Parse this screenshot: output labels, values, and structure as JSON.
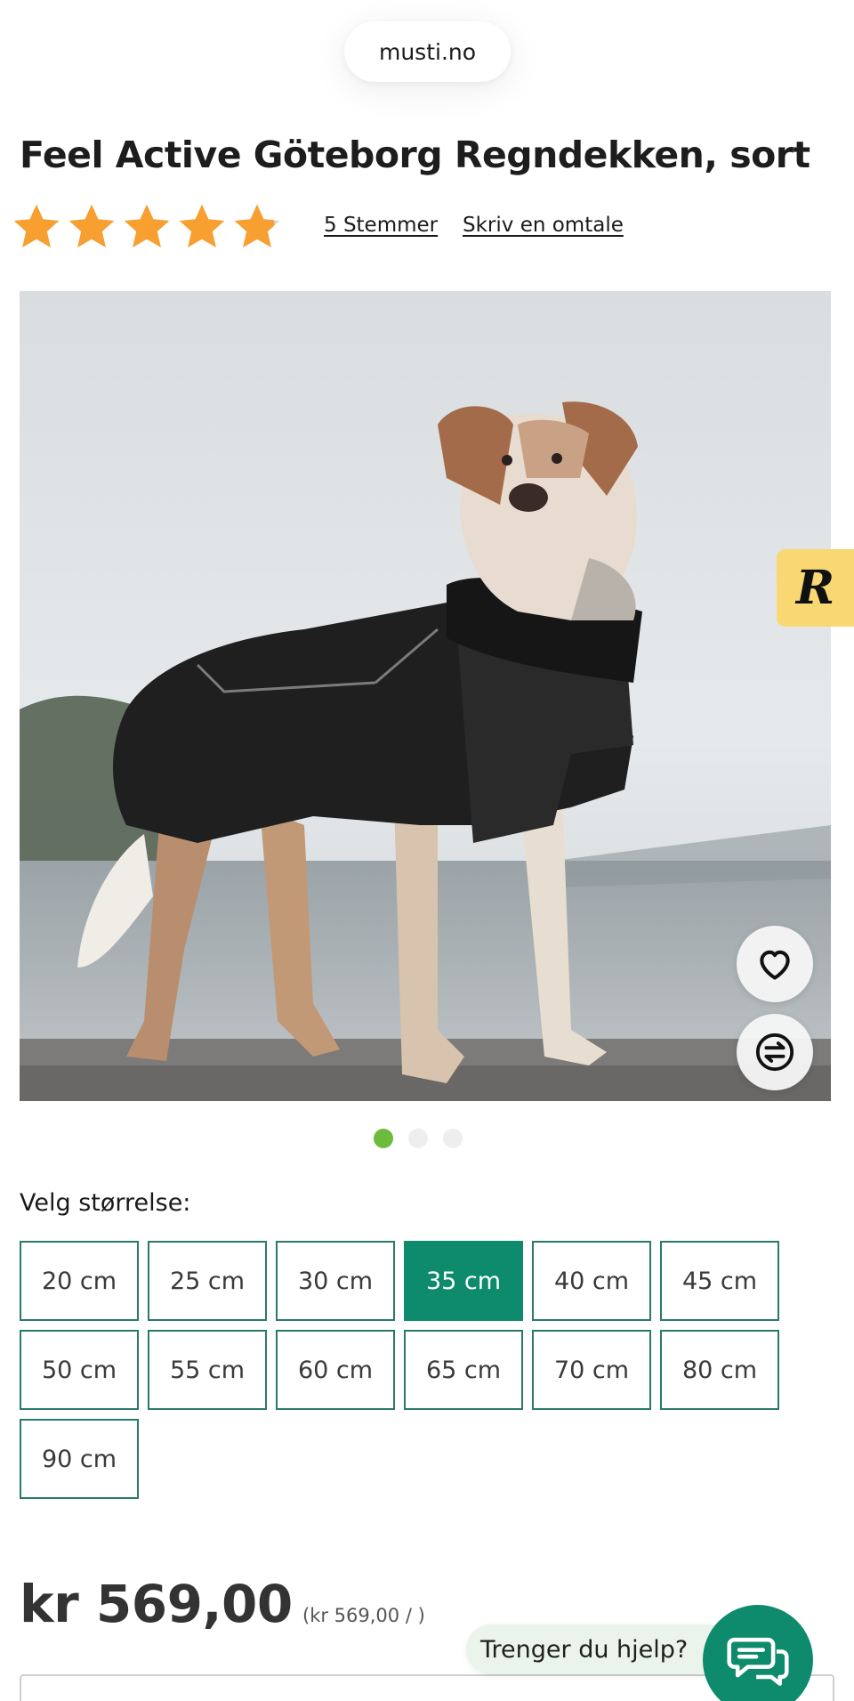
{
  "browser": {
    "url": "musti.no"
  },
  "product": {
    "title": "Feel Active Göteborg Regndekken, sort",
    "rating": {
      "stars_out_of_5": 4.6,
      "votes_label": "5 Stemmer",
      "write_review_label": "Skriv en omtale"
    },
    "image_carousel": {
      "slides": 3,
      "active_slide": 1
    },
    "icons": {
      "favorite": "heart-icon",
      "compare": "compare-arrows-icon",
      "badge": "r-badge-icon",
      "chat": "chat-icon"
    }
  },
  "size_selector": {
    "label": "Velg størrelse:",
    "options": [
      "20 cm",
      "25 cm",
      "30 cm",
      "35 cm",
      "40 cm",
      "45 cm",
      "50 cm",
      "55 cm",
      "60 cm",
      "65 cm",
      "70 cm",
      "80 cm",
      "90 cm"
    ],
    "selected": "35 cm"
  },
  "pricing": {
    "price": "kr 569,00",
    "unit_price": "(kr 569,00 / )"
  },
  "help": {
    "label": "Trenger du hjelp?"
  },
  "colors": {
    "accent_green": "#0e8a6c",
    "star_orange": "#f7a031",
    "badge_yellow": "#f9d773",
    "dot_active": "#6cbb3c"
  }
}
